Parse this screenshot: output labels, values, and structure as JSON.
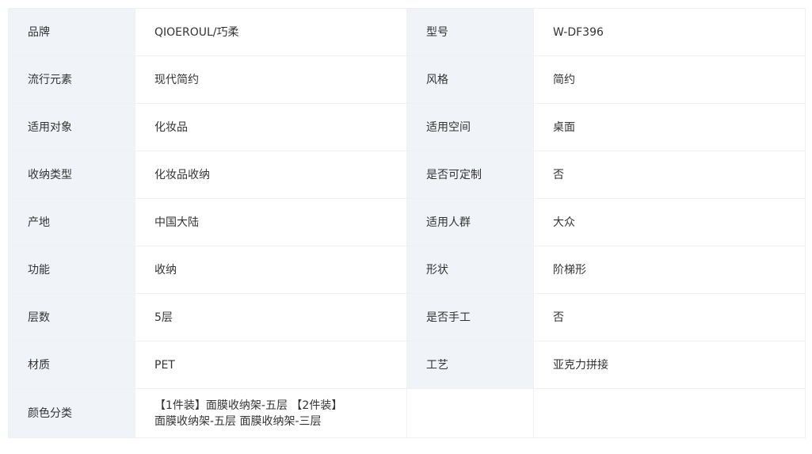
{
  "specs": {
    "rows": [
      {
        "k1": "品牌",
        "v1": "QIOEROUL/巧柔",
        "k2": "型号",
        "v2": "W-DF396"
      },
      {
        "k1": "流行元素",
        "v1": "现代简约",
        "k2": "风格",
        "v2": "简约"
      },
      {
        "k1": "适用对象",
        "v1": "化妆品",
        "k2": "适用空间",
        "v2": "桌面"
      },
      {
        "k1": "收纳类型",
        "v1": "化妆品收纳",
        "k2": "是否可定制",
        "v2": "否"
      },
      {
        "k1": "产地",
        "v1": "中国大陆",
        "k2": "适用人群",
        "v2": "大众"
      },
      {
        "k1": "功能",
        "v1": "收纳",
        "k2": "形状",
        "v2": "阶梯形"
      },
      {
        "k1": "层数",
        "v1": "5层",
        "k2": "是否手工",
        "v2": "否"
      },
      {
        "k1": "材质",
        "v1": "PET",
        "k2": "工艺",
        "v2": "亚克力拼接"
      }
    ],
    "color": {
      "label": "颜色分类",
      "line1": "【1件装】面膜收纳架-五层 【2件装】",
      "line2": "面膜收纳架-五层 面膜收纳架-三层"
    }
  },
  "colors": {
    "label_bg": "#f0f4f8",
    "value_bg": "#ffffff",
    "border": "#eef0f3",
    "text": "#333333"
  }
}
